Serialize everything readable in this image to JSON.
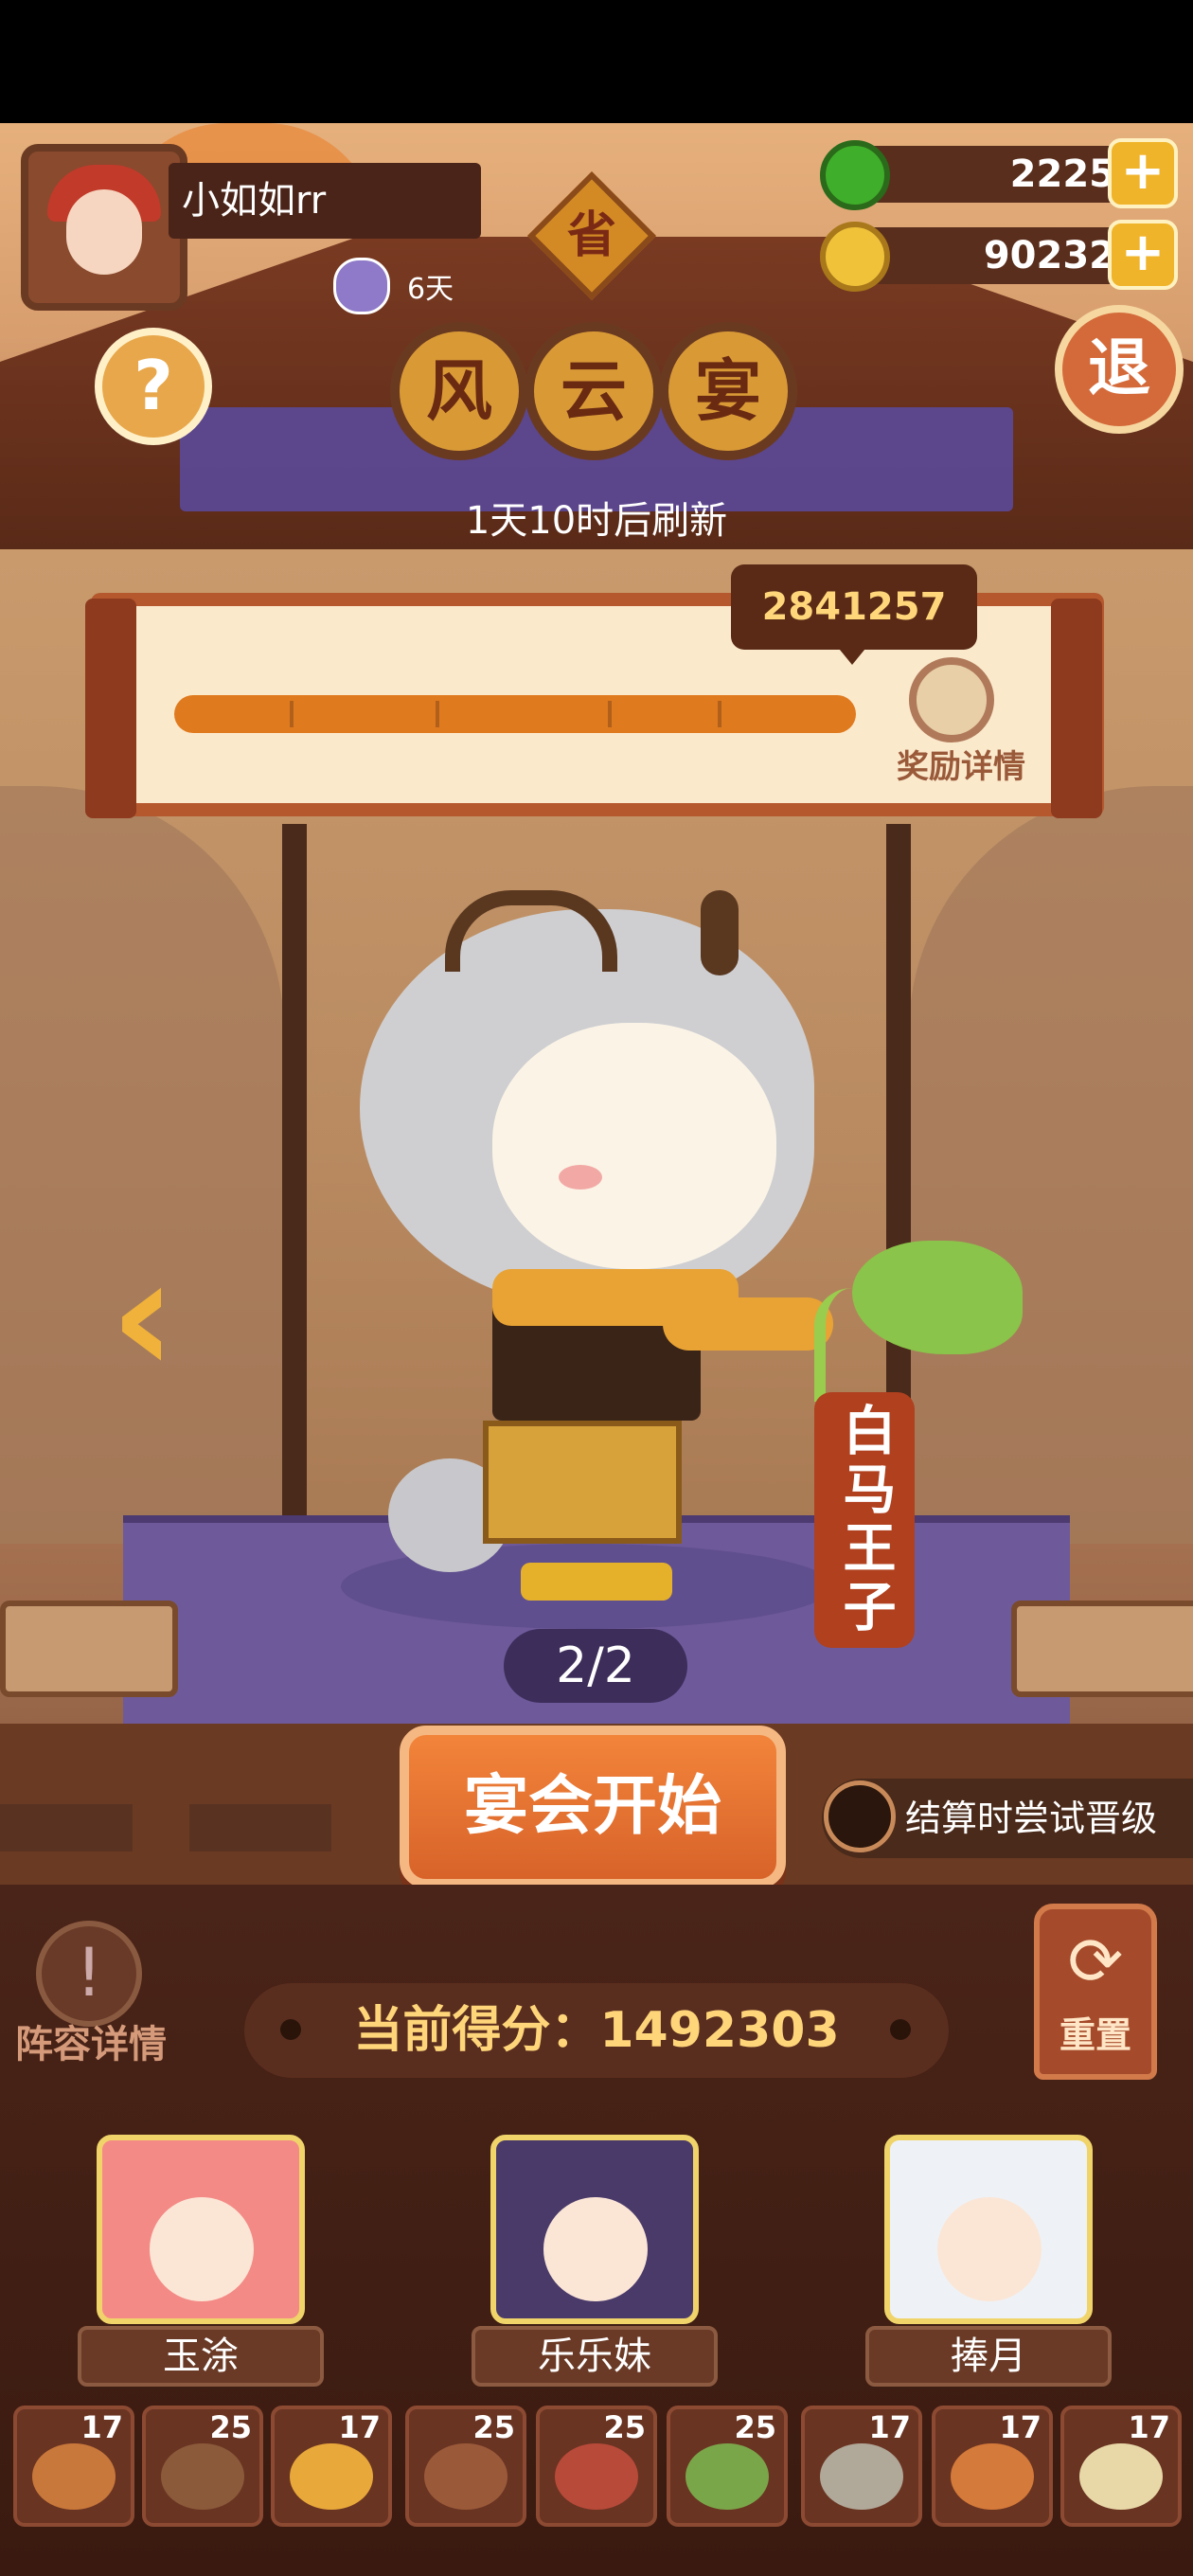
{
  "player": {
    "name": "小如如rr",
    "days": "6天"
  },
  "province": "省",
  "currency": {
    "gems": "2225",
    "coins": "90232",
    "gem_color": "#3fae2a",
    "coin_color": "#f0c23a"
  },
  "buttons": {
    "help": "?",
    "exit": "退",
    "start": "宴会开始",
    "reset": "重置",
    "lineup": "阵容详情"
  },
  "title": [
    "风",
    "云",
    "宴"
  ],
  "refresh_text": "1天10时后刷新",
  "progress": {
    "target_score": "2841257",
    "reward_label": "奖励详情"
  },
  "character": {
    "name": "白马王子"
  },
  "page_indicator": "2/2",
  "toggle": {
    "label": "结算时尝试晋级",
    "checked": false
  },
  "score": {
    "label": "当前得分：",
    "value": "1492303"
  },
  "heroes": [
    {
      "name": "玉涂",
      "color": "#f48a86"
    },
    {
      "name": "乐乐妹",
      "color": "#4a3a6a"
    },
    {
      "name": "捧月",
      "color": "#eef2f6"
    }
  ],
  "dishes": [
    {
      "count": "17",
      "color": "#c8783a"
    },
    {
      "count": "25",
      "color": "#8a5a3a"
    },
    {
      "count": "17",
      "color": "#e8a83a"
    },
    {
      "count": "25",
      "color": "#9a5a3a"
    },
    {
      "count": "25",
      "color": "#b84a3a"
    },
    {
      "count": "25",
      "color": "#7aa64a"
    },
    {
      "count": "17",
      "color": "#b0a898"
    },
    {
      "count": "17",
      "color": "#d47a3a"
    },
    {
      "count": "17",
      "color": "#e8d8a8"
    }
  ],
  "colors": {
    "accent": "#d8632a",
    "score_gold": "#ffd57a",
    "panel_brown": "#4a2418"
  }
}
